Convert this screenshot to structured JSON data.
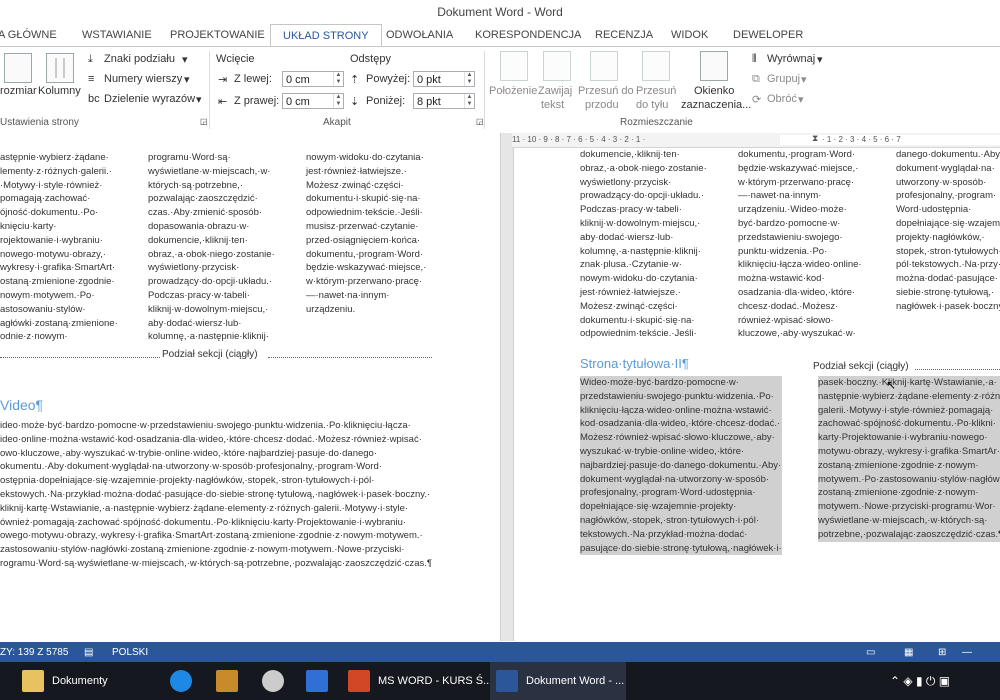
{
  "window": {
    "title": "Dokument Word - Word"
  },
  "tabs": [
    "A GŁÓWNE",
    "WSTAWIANIE",
    "PROJEKTOWANIE",
    "UKŁAD STRONY",
    "ODWOŁANIA",
    "KORESPONDENCJA",
    "RECENZJA",
    "WIDOK",
    "DEWELOPER"
  ],
  "ribbon": {
    "orient_label": "rozmiar",
    "columns_label": "Kolumny",
    "breaks_label": "Znaki podziału",
    "line_numbers_label": "Numery wierszy",
    "hyphenation_label": "Dzielenie wyrazów",
    "page_setup_group": "Ustawienia strony",
    "indent_title": "Wcięcie",
    "indent_left_label": "Z lewej:",
    "indent_left_value": "0 cm",
    "indent_right_label": "Z prawej:",
    "indent_right_value": "0 cm",
    "spacing_title": "Odstępy",
    "spacing_before_label": "Powyżej:",
    "spacing_before_value": "0 pkt",
    "spacing_after_label": "Poniżej:",
    "spacing_after_value": "8 pkt",
    "paragraph_group": "Akapit",
    "position_label": "Położenie",
    "wrap_label_1": "Zawijaj",
    "wrap_label_2": "tekst",
    "bring_forward_1": "Przesuń do",
    "bring_forward_2": "przodu",
    "send_back_1": "Przesuń",
    "send_back_2": "do tyłu",
    "selection_pane_1": "Okienko",
    "selection_pane_2": "zaznaczenia...",
    "align_label": "Wyrównaj",
    "group_label": "Grupuj",
    "rotate_label": "Obróć",
    "arrange_group": "Rozmieszczanie"
  },
  "ruler": {
    "left_numbers": "11 · 10 · 9 · 8 · 7 · 6 · 5 · 4 · 3 · 2 · 1 ·",
    "right_numbers": "· 1 · 2 · 3 · 4 · 5 · 6 · 7"
  },
  "left_pane": {
    "col1": "astępnie·wybierz·żądane·\nlementy·z·różnych·galerii.·\n·Motywy·i·style·również·\npomagają·zachować·\nójność·dokumentu.·Po·\nknięciu·karty·\nrojektowanie·i·wybraniu·\nnowego·motywu·obrazy,·\nwykresy·i·grafika·SmartArt·\nostaną·zmienione·zgodnie·\nnowym·motywem.·Po·\nastosowaniu·stylów·\nagłówki·zostaną·zmienione·\nodnie·z·nowym·",
    "col2": "programu·Word·są·\nwyświetlane·w·miejscach,·w·\nktórych·są·potrzebne,·\npozwalając·zaoszczędzić·\nczas.·Aby·zmienić·sposób·\ndopasowania·obrazu·w·\ndokumencie,·kliknij·ten·\nobraz,·a·obok·niego·zostanie·\nwyświetlony·przycisk·\nprowadzący·do·opcji·układu.·\nPodczas·pracy·w·tabeli·\nkliknij·w·dowolnym·miejscu,·\naby·dodać·wiersz·lub·\nkolumnę,·a·następnie·kliknij·",
    "col3": "nowym·widoku·do·czytania·\njest·również·łatwiejsze.·\nMożesz·zwinąć·części·\ndokumentu·i·skupić·się·na·\nodpowiednim·tekście.·Jeśli·\nmusisz·przerwać·czytanie·\nprzed·osiągnięciem·końca·\ndokumentu,·program·Word·\nbędzie·wskazywać·miejsce,·\nw·którym·przerwano·pracę·\n—·nawet·na·innym·\nurządzeniu.",
    "section_break": "Podział sekcji (ciągły)",
    "heading": "Video¶",
    "body": "ideo·może·być·bardzo·pomocne·w·przedstawieniu·swojego·punktu·widzenia.·Po·kliknięciu·łącza·\nideo·online·można·wstawić·kod·osadzania·dla·wideo,·które·chcesz·dodać.·Możesz·również·wpisać·\nowo·kluczowe,·aby·wyszukać·w·trybie·online·wideo,·które·najbardziej·pasuje·do·danego·\nokumentu.·Aby·dokument·wyglądał·na·utworzony·w·sposób·profesjonalny,·program·Word·\nostępnia·dopełniające·się·wzajemnie·projekty·nagłówków,·stopek,·stron·tytułowych·i·pól·\nekstowych.·Na·przykład·można·dodać·pasujące·do·siebie·stronę·tytułową,·nagłówek·i·pasek·boczny.·\nkliknij·kartę·Wstawianie,·a·następnie·wybierz·żądane·elementy·z·różnych·galerii.·Motywy·i·style·\nównież·pomagają·zachować·spójność·dokumentu.·Po·kliknięciu·karty·Projektowanie·i·wybraniu·\nowego·motywu·obrazy,·wykresy·i·grafika·SmartArt·zostaną·zmienione·zgodnie·z·nowym·motywem.·\nzastosowaniu·stylów·nagłówki·zostaną·zmienione·zgodnie·z·nowym·motywem.·Nowe·przyciski·\nrogramu·Word·są·wyświetlane·w·miejscach,·w·których·są·potrzebne,·pozwalając·zaoszczędzić·czas.¶"
  },
  "right_pane": {
    "col1": "dokumencie,·kliknij·ten·\nobraz,·a·obok·niego·zostanie·\nwyświetlony·przycisk·\nprowadzący·do·opcji·układu.·\nPodczas·pracy·w·tabeli·\nkliknij·w·dowolnym·miejscu,·\naby·dodać·wiersz·lub·\nkolumnę,·a·następnie·kliknij·\nznak·plusa.·Czytanie·w·\nnowym·widoku·do·czytania·\njest·również·łatwiejsze.·\nMożesz·zwinąć·części·\ndokumentu·i·skupić·się·na·\nodpowiednim·tekście.·Jeśli·",
    "col2": "dokumentu,·program·Word·\nbędzie·wskazywać·miejsce,·\nw·którym·przerwano·pracę·\n—·nawet·na·innym·\nurządzeniu.·Wideo·może·\nbyć·bardzo·pomocne·w·\nprzedstawieniu·swojego·\npunktu·widzenia.·Po·\nkliknięciu·łącza·wideo·online·\nmożna·wstawić·kod·\nosadzania·dla·wideo,·które·\nchcesz·dodać.·Możesz·\nrównież·wpisać·słowo·\nkluczowe,·aby·wyszukać·w·",
    "col3": "danego·dokumentu.·Aby·\ndokument·wyglądał·na·\nutworzony·w·sposób·\nprofesjonalny,·program·\nWord·udostępnia·\ndopełniające·się·wzajem·\nprojekty·nagłówków,·\nstopek,·stron·tytułowych·\npól·tekstowych.·Na·przy·\nmożna·dodać·pasujące·\nsiebie·stronę·tytułową,·\nnagłówek·i·pasek·boczny",
    "heading": "Strona·tytułowa·II¶",
    "section_break": "Podział sekcji (ciągły)",
    "sel_col1": "Wideo·może·być·bardzo·pomocne·w·\nprzedstawieniu·swojego·punktu·widzenia.·Po·\nkliknięciu·łącza·wideo·online·można·wstawić·\nkod·osadzania·dla·wideo,·które·chcesz·dodać.·\nMożesz·również·wpisać·słowo·kluczowe,·aby·\nwyszukać·w·trybie·online·wideo,·które·\nnajbardziej·pasuje·do·danego·dokumentu.·Aby·\ndokument·wyglądał·na·utworzony·w·sposób·\nprofesjonalny,·program·Word·udostępnia·\ndopełniające·się·wzajemnie·projekty·\nnagłówków,·stopek,·stron·tytułowych·i·pól·\ntekstowych.·Na·przykład·można·dodać·\npasujące·do·siebie·stronę·tytułową,·nagłówek·i·",
    "sel_col2": "pasek·boczny.·Kliknij·kartę·Wstawianie,·a·\nnastępnie·wybierz·żądane·elementy·z·różn·\ngalerii.·Motywy·i·style·również·pomagają·\nzachować·spójność·dokumentu.·Po·klikni·\nkarty·Projektowanie·i·wybraniu·nowego·\nmotywu·obrazy,·wykresy·i·grafika·SmartAr·\nzostaną·zmienione·zgodnie·z·nowym·\nmotywem.·Po·zastosowaniu·stylów·nagłów·\nzostaną·zmienione·zgodnie·z·nowym·\nmotywem.·Nowe·przyciski·programu·Wor·\nwyświetlane·w·miejscach,·w·których·są·\npotrzebne,·pozwalając·zaoszczędzić·czas.¶"
  },
  "status": {
    "page_info": "ZY: 139 Z 5785",
    "language": "POLSKI"
  },
  "taskbar": {
    "documents_label": "Dokumenty",
    "ppt_label": "MS WORD - KURS Ś...",
    "word_label": "Dokument Word - ..."
  }
}
